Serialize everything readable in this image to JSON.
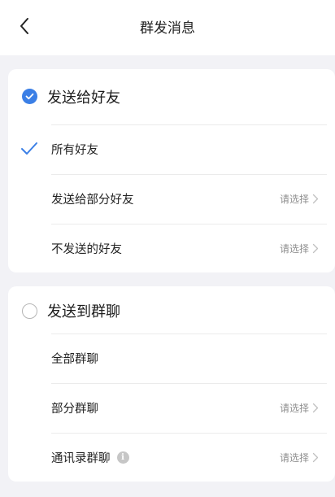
{
  "header": {
    "title": "群发消息"
  },
  "section_friends": {
    "label": "发送给好友",
    "selected": true,
    "rows": [
      {
        "label": "所有好友",
        "checked": true
      },
      {
        "label": "发送给部分好友",
        "action": "请选择"
      },
      {
        "label": "不发送的好友",
        "action": "请选择"
      }
    ]
  },
  "section_groups": {
    "label": "发送到群聊",
    "selected": false,
    "rows": [
      {
        "label": "全部群聊"
      },
      {
        "label": "部分群聊",
        "action": "请选择"
      },
      {
        "label": "通讯录群聊",
        "action": "请选择",
        "info_icon": "info-icon"
      }
    ]
  },
  "colors": {
    "accent": "#3b7fe6",
    "background": "#f2f2f6"
  }
}
